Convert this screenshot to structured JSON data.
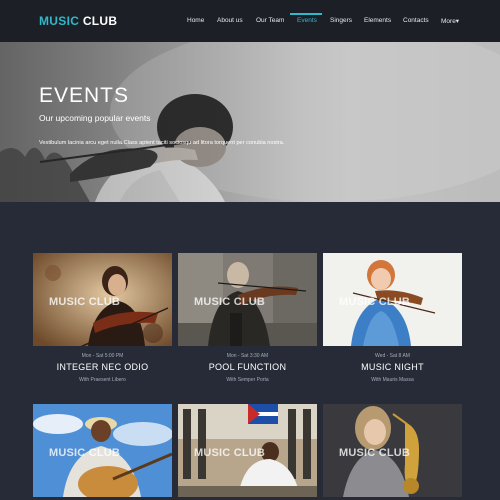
{
  "nav": {
    "logo_part1": "MUSIC",
    "logo_part2": "CLUB",
    "items": [
      {
        "label": "Home"
      },
      {
        "label": "About us"
      },
      {
        "label": "Our Team"
      },
      {
        "label": "Events"
      },
      {
        "label": "Singers"
      },
      {
        "label": "Elements"
      },
      {
        "label": "Contacts"
      },
      {
        "label": "More▾"
      }
    ],
    "active_item": "Events",
    "accent_color": "#31b8c9"
  },
  "hero": {
    "title": "EVENTS",
    "subtitle": "Our upcoming popular events",
    "description": "Vestibulum lacinia arcu eget nulla.Class aptent taciti sociosqu ad litora torquent per conubia nostra."
  },
  "events": [
    {
      "watermark": "MUSIC CLUB",
      "time": "Mon - Sat 5:00 PM",
      "title": "INTEGER NEC ODIO",
      "with": "With Praesent Libero",
      "image": "violinist-woman-photo"
    },
    {
      "watermark": "MUSIC CLUB",
      "time": "Mon - Sat 3:30 AM",
      "title": "POOL FUNCTION",
      "with": "With Semper Porta",
      "image": "violinist-man-street-photo"
    },
    {
      "watermark": "MUSIC CLUB",
      "time": "Wed - Sat 8 AM",
      "title": "MUSIC NIGHT",
      "with": "With Mauris Massa",
      "image": "girl-violin-photo"
    },
    {
      "watermark": "MUSIC CLUB",
      "image": "guitarist-photo"
    },
    {
      "watermark": "MUSIC CLUB",
      "image": "street-trumpet-band-photo"
    },
    {
      "watermark": "MUSIC CLUB",
      "image": "saxophone-woman-photo"
    }
  ]
}
